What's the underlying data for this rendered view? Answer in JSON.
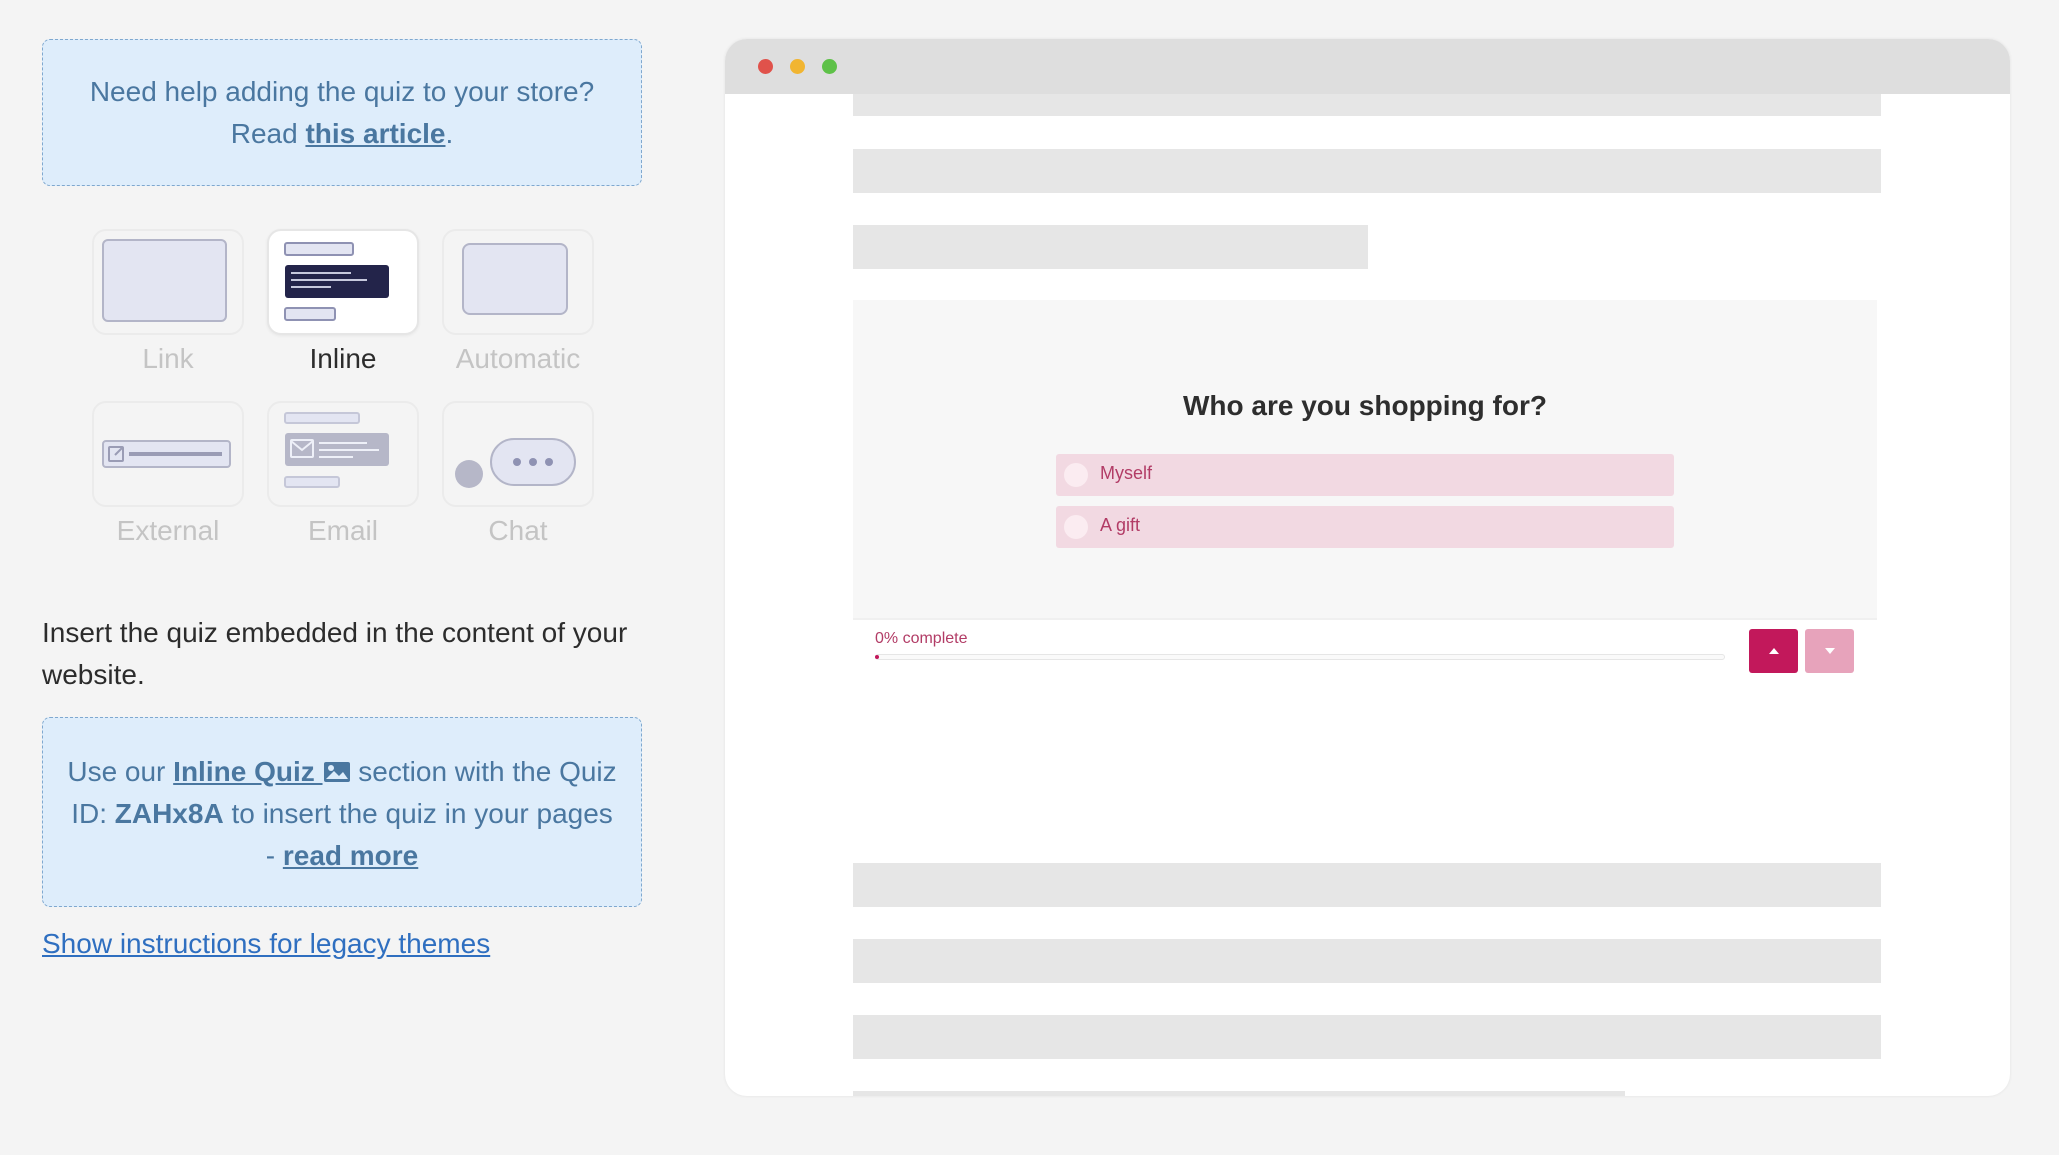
{
  "help_box": {
    "line1": "Need help adding the quiz to your store?",
    "read_prefix": "Read ",
    "link_text": "this article",
    "suffix": "."
  },
  "display_types": [
    {
      "label": "Link",
      "icon": "link-card-icon",
      "active": false
    },
    {
      "label": "Inline",
      "icon": "inline-embed-icon",
      "active": true
    },
    {
      "label": "Automatic",
      "icon": "popup-card-icon",
      "active": false
    },
    {
      "label": "External",
      "icon": "external-link-icon",
      "active": false
    },
    {
      "label": "Email",
      "icon": "email-embed-icon",
      "active": false
    },
    {
      "label": "Chat",
      "icon": "chat-bubble-icon",
      "active": false
    }
  ],
  "description": "Insert the quiz embedded in the content of your website.",
  "embed_box": {
    "prefix": "Use our ",
    "section_link": "Inline Quiz ",
    "section_icon": "image-icon",
    "middle": " section with the Quiz ID: ",
    "quiz_id": "ZAHx8A",
    "after_id": " to insert the quiz in your pages - ",
    "read_more": "read more"
  },
  "legacy_link": "Show instructions for legacy themes",
  "preview": {
    "window_dots": [
      "#e0524b",
      "#f1b531",
      "#5ec148"
    ],
    "question": "Who are you shopping for?",
    "answers": [
      "Myself",
      "A gift"
    ],
    "progress_label": "0% complete",
    "progress": 0,
    "accent": "#c2185b",
    "accent_light": "#e7a3bb",
    "nav_up_icon": "triangle-up-icon",
    "nav_down_icon": "triangle-down-icon"
  }
}
